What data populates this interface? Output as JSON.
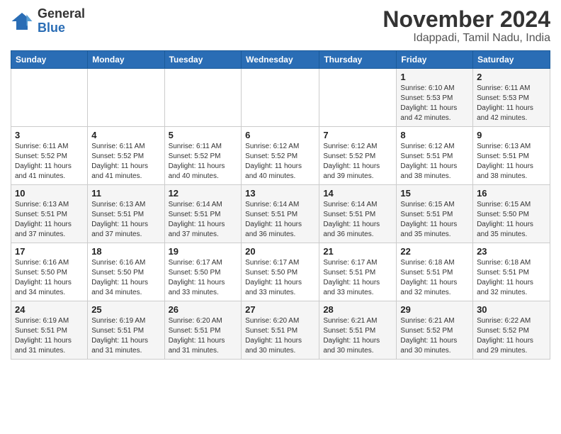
{
  "header": {
    "logo": {
      "general": "General",
      "blue": "Blue"
    },
    "title": "November 2024",
    "subtitle": "Idappadi, Tamil Nadu, India"
  },
  "calendar": {
    "days": [
      "Sunday",
      "Monday",
      "Tuesday",
      "Wednesday",
      "Thursday",
      "Friday",
      "Saturday"
    ],
    "weeks": [
      [
        {
          "day": "",
          "info": ""
        },
        {
          "day": "",
          "info": ""
        },
        {
          "day": "",
          "info": ""
        },
        {
          "day": "",
          "info": ""
        },
        {
          "day": "",
          "info": ""
        },
        {
          "day": "1",
          "info": "Sunrise: 6:10 AM\nSunset: 5:53 PM\nDaylight: 11 hours\nand 42 minutes."
        },
        {
          "day": "2",
          "info": "Sunrise: 6:11 AM\nSunset: 5:53 PM\nDaylight: 11 hours\nand 42 minutes."
        }
      ],
      [
        {
          "day": "3",
          "info": "Sunrise: 6:11 AM\nSunset: 5:52 PM\nDaylight: 11 hours\nand 41 minutes."
        },
        {
          "day": "4",
          "info": "Sunrise: 6:11 AM\nSunset: 5:52 PM\nDaylight: 11 hours\nand 41 minutes."
        },
        {
          "day": "5",
          "info": "Sunrise: 6:11 AM\nSunset: 5:52 PM\nDaylight: 11 hours\nand 40 minutes."
        },
        {
          "day": "6",
          "info": "Sunrise: 6:12 AM\nSunset: 5:52 PM\nDaylight: 11 hours\nand 40 minutes."
        },
        {
          "day": "7",
          "info": "Sunrise: 6:12 AM\nSunset: 5:52 PM\nDaylight: 11 hours\nand 39 minutes."
        },
        {
          "day": "8",
          "info": "Sunrise: 6:12 AM\nSunset: 5:51 PM\nDaylight: 11 hours\nand 38 minutes."
        },
        {
          "day": "9",
          "info": "Sunrise: 6:13 AM\nSunset: 5:51 PM\nDaylight: 11 hours\nand 38 minutes."
        }
      ],
      [
        {
          "day": "10",
          "info": "Sunrise: 6:13 AM\nSunset: 5:51 PM\nDaylight: 11 hours\nand 37 minutes."
        },
        {
          "day": "11",
          "info": "Sunrise: 6:13 AM\nSunset: 5:51 PM\nDaylight: 11 hours\nand 37 minutes."
        },
        {
          "day": "12",
          "info": "Sunrise: 6:14 AM\nSunset: 5:51 PM\nDaylight: 11 hours\nand 37 minutes."
        },
        {
          "day": "13",
          "info": "Sunrise: 6:14 AM\nSunset: 5:51 PM\nDaylight: 11 hours\nand 36 minutes."
        },
        {
          "day": "14",
          "info": "Sunrise: 6:14 AM\nSunset: 5:51 PM\nDaylight: 11 hours\nand 36 minutes."
        },
        {
          "day": "15",
          "info": "Sunrise: 6:15 AM\nSunset: 5:51 PM\nDaylight: 11 hours\nand 35 minutes."
        },
        {
          "day": "16",
          "info": "Sunrise: 6:15 AM\nSunset: 5:50 PM\nDaylight: 11 hours\nand 35 minutes."
        }
      ],
      [
        {
          "day": "17",
          "info": "Sunrise: 6:16 AM\nSunset: 5:50 PM\nDaylight: 11 hours\nand 34 minutes."
        },
        {
          "day": "18",
          "info": "Sunrise: 6:16 AM\nSunset: 5:50 PM\nDaylight: 11 hours\nand 34 minutes."
        },
        {
          "day": "19",
          "info": "Sunrise: 6:17 AM\nSunset: 5:50 PM\nDaylight: 11 hours\nand 33 minutes."
        },
        {
          "day": "20",
          "info": "Sunrise: 6:17 AM\nSunset: 5:50 PM\nDaylight: 11 hours\nand 33 minutes."
        },
        {
          "day": "21",
          "info": "Sunrise: 6:17 AM\nSunset: 5:51 PM\nDaylight: 11 hours\nand 33 minutes."
        },
        {
          "day": "22",
          "info": "Sunrise: 6:18 AM\nSunset: 5:51 PM\nDaylight: 11 hours\nand 32 minutes."
        },
        {
          "day": "23",
          "info": "Sunrise: 6:18 AM\nSunset: 5:51 PM\nDaylight: 11 hours\nand 32 minutes."
        }
      ],
      [
        {
          "day": "24",
          "info": "Sunrise: 6:19 AM\nSunset: 5:51 PM\nDaylight: 11 hours\nand 31 minutes."
        },
        {
          "day": "25",
          "info": "Sunrise: 6:19 AM\nSunset: 5:51 PM\nDaylight: 11 hours\nand 31 minutes."
        },
        {
          "day": "26",
          "info": "Sunrise: 6:20 AM\nSunset: 5:51 PM\nDaylight: 11 hours\nand 31 minutes."
        },
        {
          "day": "27",
          "info": "Sunrise: 6:20 AM\nSunset: 5:51 PM\nDaylight: 11 hours\nand 30 minutes."
        },
        {
          "day": "28",
          "info": "Sunrise: 6:21 AM\nSunset: 5:51 PM\nDaylight: 11 hours\nand 30 minutes."
        },
        {
          "day": "29",
          "info": "Sunrise: 6:21 AM\nSunset: 5:52 PM\nDaylight: 11 hours\nand 30 minutes."
        },
        {
          "day": "30",
          "info": "Sunrise: 6:22 AM\nSunset: 5:52 PM\nDaylight: 11 hours\nand 29 minutes."
        }
      ]
    ]
  }
}
